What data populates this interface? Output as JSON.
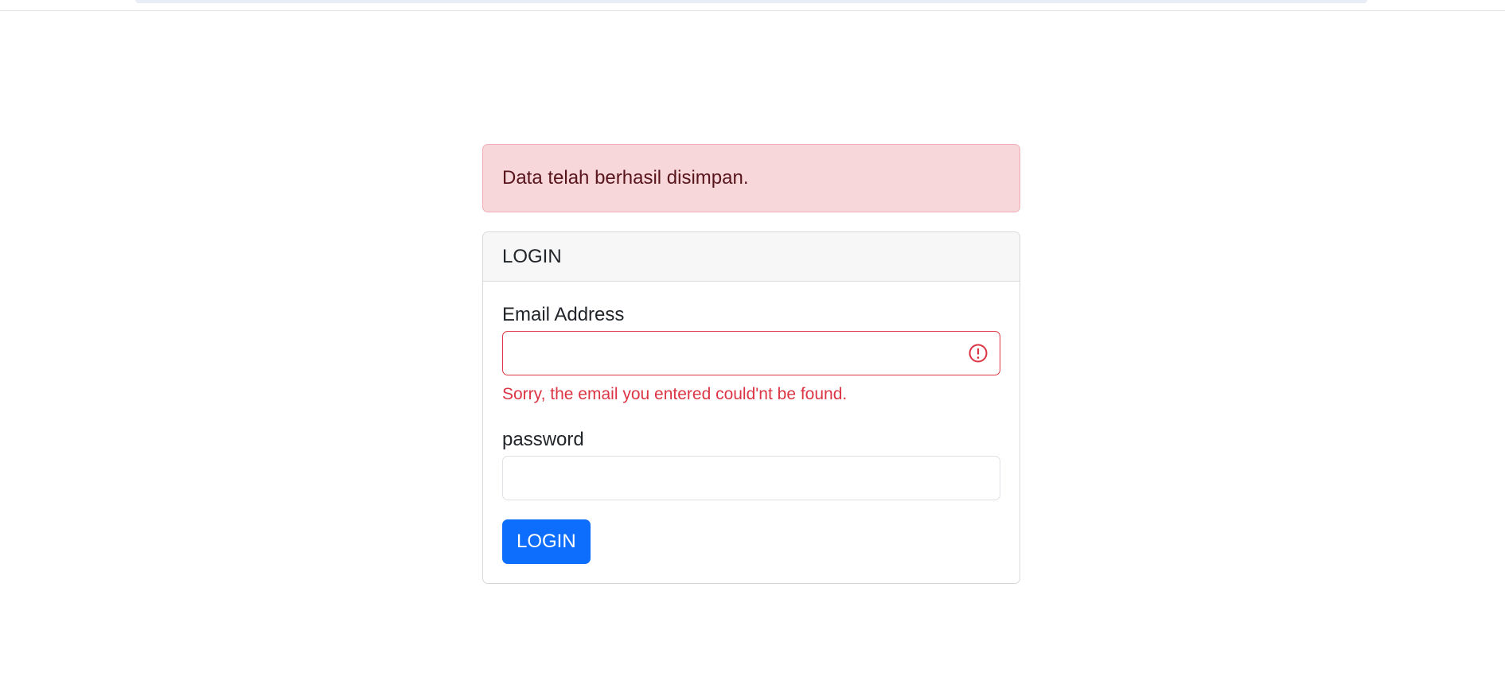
{
  "alert": {
    "message": "Data telah berhasil disimpan.",
    "type": "danger",
    "color": "#f8d7da"
  },
  "card": {
    "header": "LOGIN"
  },
  "form": {
    "email": {
      "label": "Email Address",
      "value": "",
      "placeholder": "",
      "state": "invalid",
      "icon": "exclamation-circle-icon",
      "error": "Sorry, the email you entered could'nt be found."
    },
    "password": {
      "label": "password",
      "value": "",
      "placeholder": ""
    },
    "submit_label": "LOGIN"
  },
  "colors": {
    "primary": "#0d6efd",
    "danger": "#dc3545",
    "alert_text": "#58151c"
  }
}
